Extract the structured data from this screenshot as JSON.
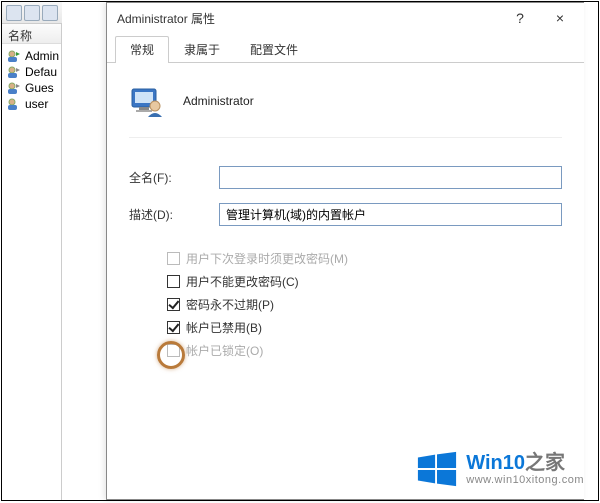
{
  "leftPane": {
    "header": "名称",
    "items": [
      {
        "label": "Admini"
      },
      {
        "label": "Defau"
      },
      {
        "label": "Gues"
      },
      {
        "label": "user"
      }
    ]
  },
  "dialog": {
    "title": "Administrator 属性",
    "help": "?",
    "close": "×",
    "tabs": [
      {
        "label": "常规",
        "active": true
      },
      {
        "label": "隶属于",
        "active": false
      },
      {
        "label": "配置文件",
        "active": false
      }
    ],
    "identityName": "Administrator",
    "form": {
      "fullNameLabel": "全名(F):",
      "fullNameValue": "",
      "descLabel": "描述(D):",
      "descValue": "管理计算机(域)的内置帐户"
    },
    "checks": [
      {
        "label": "用户下次登录时须更改密码(M)",
        "checked": false,
        "disabled": true
      },
      {
        "label": "用户不能更改密码(C)",
        "checked": false,
        "disabled": false
      },
      {
        "label": "密码永不过期(P)",
        "checked": true,
        "disabled": false
      },
      {
        "label": "帐户已禁用(B)",
        "checked": true,
        "disabled": false
      },
      {
        "label": "帐户已锁定(O)",
        "checked": false,
        "disabled": true
      }
    ]
  },
  "watermark": {
    "brandBlue": "Win10",
    "brandGray": "之家",
    "url": "www.win10xitong.com"
  },
  "colors": {
    "accent": "#0b77d8",
    "ring": "#b97a3a"
  }
}
